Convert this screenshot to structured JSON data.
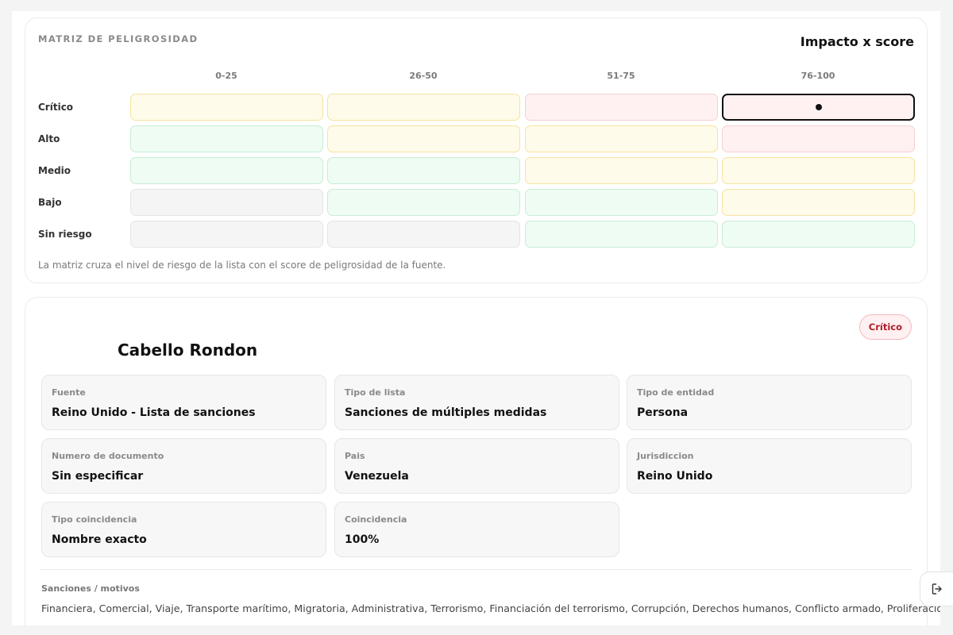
{
  "matrix": {
    "title": "MATRIZ DE PELIGROSIDAD",
    "impact_label": "Impacto x score",
    "columns": [
      "0-25",
      "26-50",
      "51-75",
      "76-100"
    ],
    "rows": [
      "Crítico",
      "Alto",
      "Medio",
      "Bajo",
      "Sin riesgo"
    ],
    "cell_colors": [
      [
        "yellow",
        "yellow",
        "red",
        "red"
      ],
      [
        "green",
        "yellow",
        "yellow",
        "red"
      ],
      [
        "green",
        "green",
        "yellow",
        "yellow"
      ],
      [
        "gray",
        "green",
        "green",
        "yellow"
      ],
      [
        "gray",
        "gray",
        "green",
        "green"
      ]
    ],
    "selected_cell": {
      "row": "Crítico",
      "column": "76-100"
    },
    "note": "La matriz cruza el nivel de riesgo de la lista con el score de peligrosidad de la fuente.",
    "colors": {
      "yellow": "#fffbea",
      "red": "#fff1f1",
      "green": "#effcf3",
      "gray": "#f5f5f5"
    }
  },
  "detail": {
    "name": "Cabello Rondon",
    "badge": "Crítico",
    "badge_color": "#b01c2a",
    "fields": [
      {
        "label": "Fuente",
        "value": "Reino Unido - Lista de sanciones"
      },
      {
        "label": "Tipo de lista",
        "value": "Sanciones de múltiples medidas"
      },
      {
        "label": "Tipo de entidad",
        "value": "Persona"
      },
      {
        "label": "Numero de documento",
        "value": "Sin especificar"
      },
      {
        "label": "Pais",
        "value": "Venezuela"
      },
      {
        "label": "Jurisdiccion",
        "value": "Reino Unido"
      },
      {
        "label": "Tipo coincidencia",
        "value": "Nombre exacto"
      },
      {
        "label": "Coincidencia",
        "value": "100%"
      }
    ],
    "sanctions_label": "Sanciones / motivos",
    "sanctions_text": "Financiera, Comercial, Viaje, Transporte marítimo, Migratoria, Administrativa, Terrorismo, Financiación del terrorismo, Corrupción, Derechos humanos, Conflicto armado, Proliferación de armas"
  },
  "side_button": {
    "icon": "logout-icon"
  }
}
